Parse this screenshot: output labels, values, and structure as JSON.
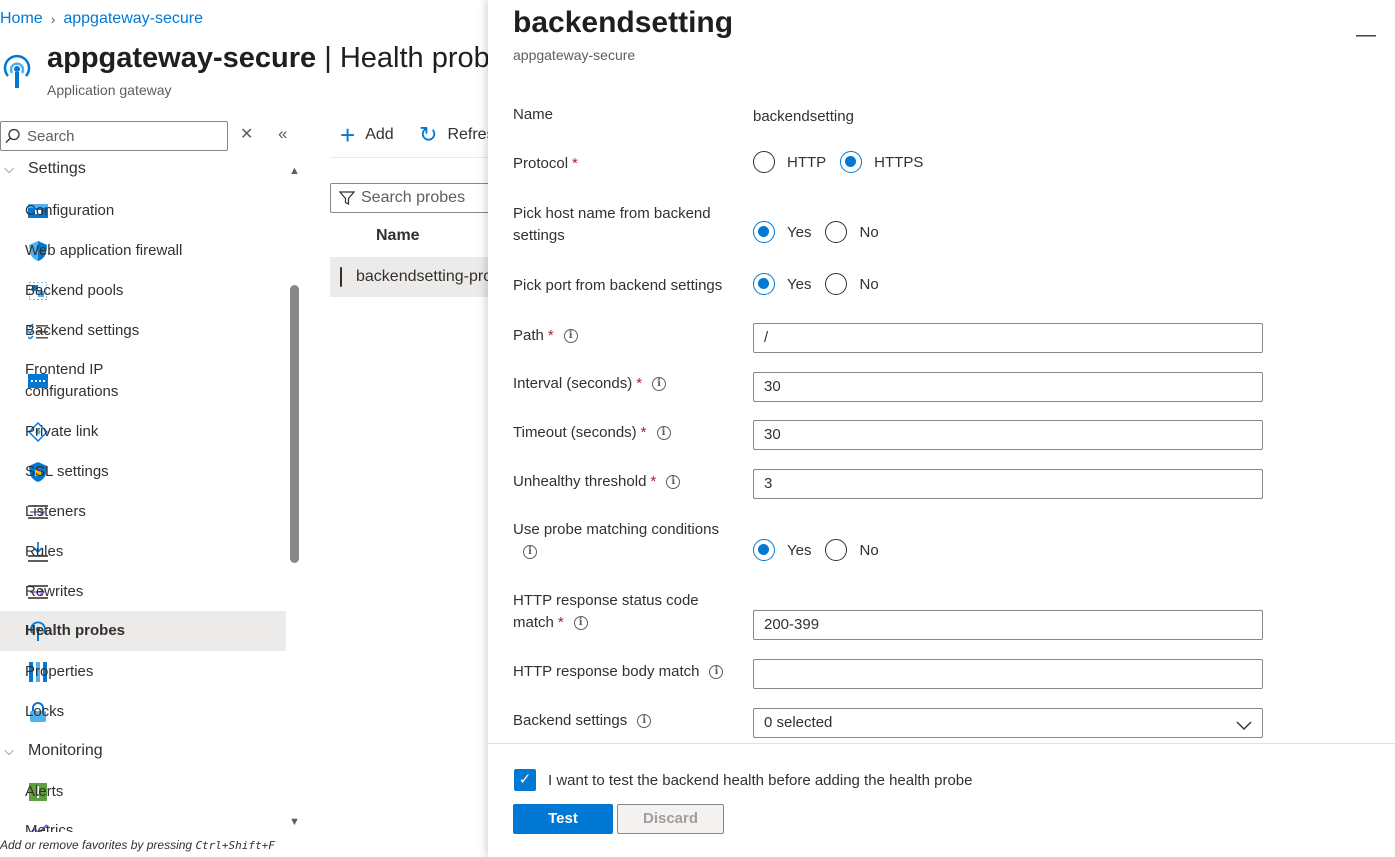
{
  "breadcrumb": {
    "home": "Home",
    "current": "appgateway-secure"
  },
  "page": {
    "resource": "appgateway-secure",
    "separator": "|",
    "blade": "Health probes",
    "subtitle": "Application gateway"
  },
  "sidebar": {
    "search_placeholder": "Search",
    "groups": {
      "settings": "Settings",
      "monitoring": "Monitoring"
    },
    "items": [
      {
        "label": "Configuration",
        "icon": "configuration-icon"
      },
      {
        "label": "Web application firewall",
        "icon": "waf-shield-icon"
      },
      {
        "label": "Backend pools",
        "icon": "backend-pools-icon"
      },
      {
        "label": "Backend settings",
        "icon": "backend-settings-icon"
      },
      {
        "label": "Frontend IP configurations",
        "icon": "frontend-ip-icon"
      },
      {
        "label": "Private link",
        "icon": "private-link-icon"
      },
      {
        "label": "SSL settings",
        "icon": "ssl-shield-icon"
      },
      {
        "label": "Listeners",
        "icon": "listeners-icon"
      },
      {
        "label": "Rules",
        "icon": "rules-icon"
      },
      {
        "label": "Rewrites",
        "icon": "rewrites-icon"
      },
      {
        "label": "Health probes",
        "icon": "health-probe-icon",
        "selected": true
      },
      {
        "label": "Properties",
        "icon": "properties-icon"
      },
      {
        "label": "Locks",
        "icon": "lock-icon"
      }
    ],
    "monitoring_items": [
      {
        "label": "Alerts",
        "icon": "alerts-icon"
      },
      {
        "label": "Metrics",
        "icon": "metrics-icon"
      }
    ],
    "fav_hint_prefix": "Add or remove favorites by pressing",
    "fav_hint_keys": "Ctrl+Shift+F"
  },
  "commands": {
    "add": "Add",
    "refresh": "Refresh"
  },
  "list": {
    "filter_placeholder": "Search probes",
    "column_name": "Name",
    "rows": [
      {
        "name": "backendsetting-probe"
      }
    ]
  },
  "panel": {
    "title": "backendsetting",
    "subtitle": "appgateway-secure",
    "name_label": "Name",
    "name_value": "backendsetting",
    "protocol_label": "Protocol",
    "protocol_options": [
      "HTTP",
      "HTTPS"
    ],
    "protocol_selected": "HTTPS",
    "pick_host_label": "Pick host name from backend settings",
    "pick_port_label": "Pick port from backend settings",
    "yes": "Yes",
    "no": "No",
    "path_label": "Path",
    "path_value": "/",
    "interval_label": "Interval (seconds)",
    "interval_value": "30",
    "timeout_label": "Timeout (seconds)",
    "timeout_value": "30",
    "unhealthy_label": "Unhealthy threshold",
    "unhealthy_value": "3",
    "match_label": "Use probe matching conditions",
    "status_label": "HTTP response status code match",
    "status_value": "200-399",
    "body_label": "HTTP response body match",
    "body_value": "",
    "backend_settings_label": "Backend settings",
    "backend_settings_value": "0 selected",
    "test_checkbox_label": "I want to test the backend health before adding the health probe",
    "test_button": "Test",
    "discard_button": "Discard"
  },
  "colors": {
    "accent": "#0078d4",
    "required": "#a4262c",
    "selected_bg": "#edebe9"
  }
}
